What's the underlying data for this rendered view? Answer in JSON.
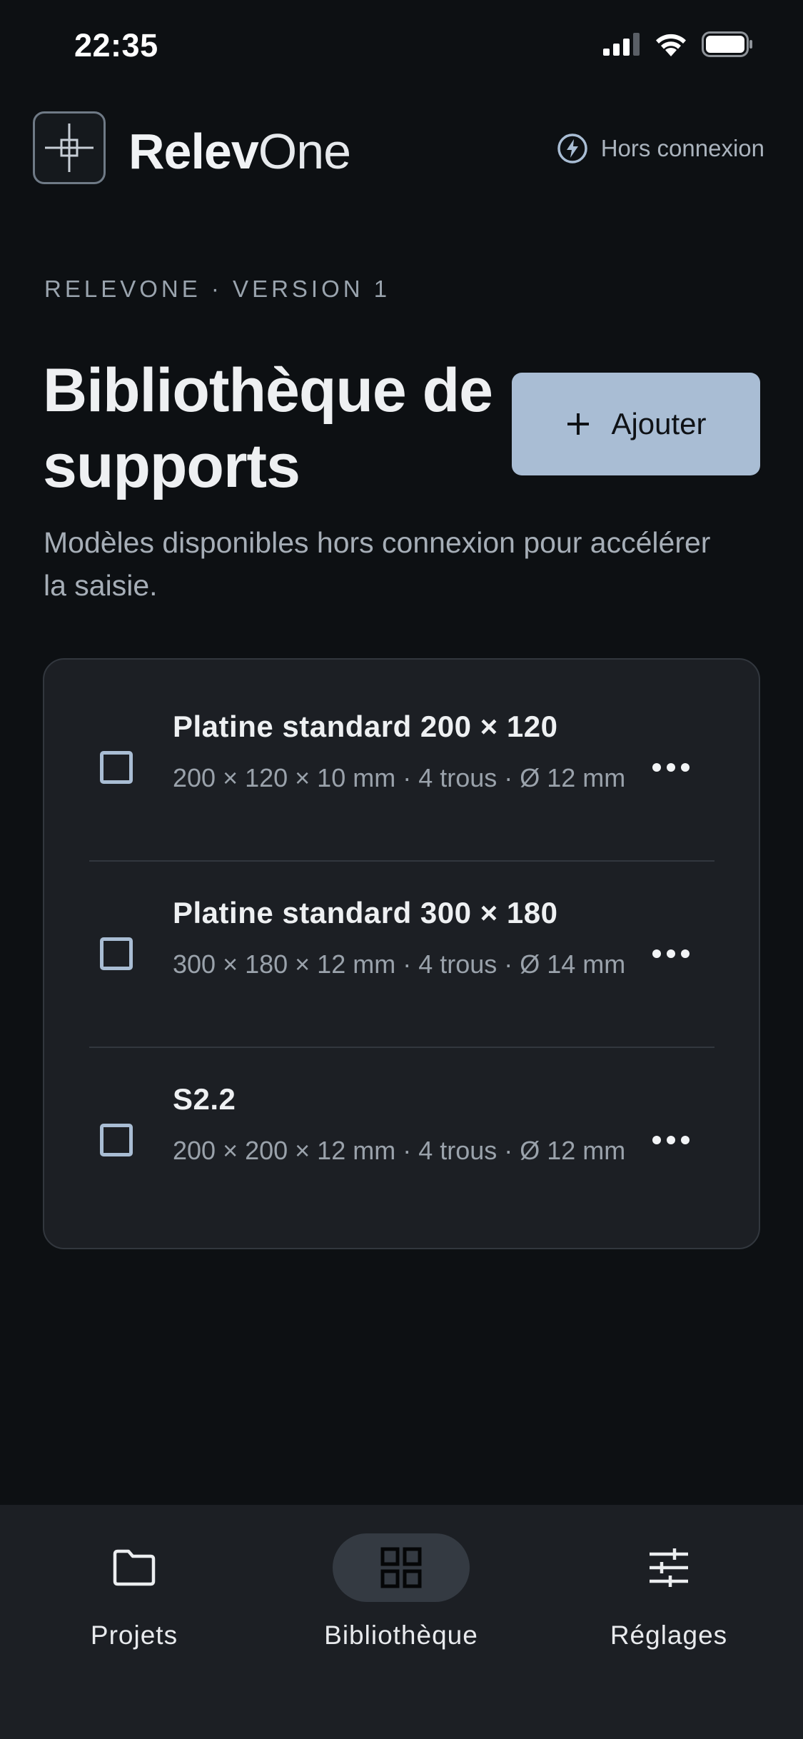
{
  "status_bar": {
    "time": "22:35",
    "icons": [
      "signal-icon",
      "wifi-icon",
      "battery-icon"
    ]
  },
  "header": {
    "app_name_part1": "Relev",
    "app_name_part2": "One",
    "logo_icon": "crosshair-icon",
    "offline_icon": "bolt-icon",
    "offline_label": "Hors connexion"
  },
  "hero": {
    "eyebrow": "RELEVONE · VERSION 1",
    "title": "Bibliothèque de supports",
    "subtitle": "Modèles disponibles hors connexion pour accélérer la saisie.",
    "add_button_label": "Ajouter",
    "add_button_icon": "plus-icon"
  },
  "supports": [
    {
      "title": "Platine standard 200 × 120",
      "meta": "200 × 120 × 10 mm · 4 trous · Ø 12 mm",
      "checked": false
    },
    {
      "title": "Platine standard 300 × 180",
      "meta": "300 × 180 × 12 mm · 4 trous · Ø 14 mm",
      "checked": false
    },
    {
      "title": "S2.2",
      "meta": "200 × 200 × 12 mm · 4 trous · Ø 12 mm",
      "checked": false
    }
  ],
  "bottom_nav": {
    "items": [
      {
        "label": "Projets",
        "icon": "folder-icon",
        "active": false
      },
      {
        "label": "Bibliothèque",
        "icon": "grid-icon",
        "active": true
      },
      {
        "label": "Réglages",
        "icon": "sliders-icon",
        "active": false
      }
    ]
  },
  "colors": {
    "background": "#0d1013",
    "surface": "#1c1f24",
    "accent": "#a9bdd4",
    "text_primary": "#eef0f2",
    "text_secondary": "#9aa2ab"
  }
}
